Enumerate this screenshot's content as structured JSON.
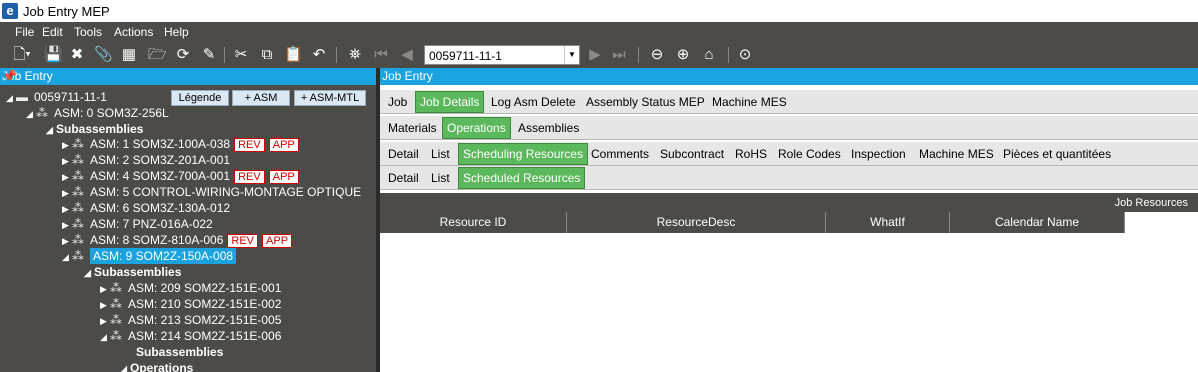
{
  "window": {
    "title": "Job Entry MEP",
    "logo": "e"
  },
  "menu": [
    "File",
    "Edit",
    "Tools",
    "Actions",
    "Help"
  ],
  "toolbar": {
    "job_number": "0059711-11-1"
  },
  "left_panel": {
    "title": "Job Entry",
    "buttons": {
      "legend": "Légende",
      "add_asm": "+ ASM",
      "add_asm_mtl": "+ ASM-MTL"
    },
    "tree": [
      {
        "label": "0059711-11-1"
      },
      {
        "label": "ASM: 0 SOM3Z-256L"
      },
      {
        "label": "Subassemblies"
      },
      {
        "label": "ASM: 1 SOM3Z-100A-038",
        "rev": "REV",
        "app": "APP"
      },
      {
        "label": "ASM: 2 SOM3Z-201A-001"
      },
      {
        "label": "ASM: 4 SOM3Z-700A-001",
        "rev": "REV",
        "app": "APP"
      },
      {
        "label": "ASM: 5 CONTROL-WIRING-MONTAGE OPTIQUE"
      },
      {
        "label": "ASM: 6 SOM3Z-130A-012"
      },
      {
        "label": "ASM: 7 PNZ-016A-022"
      },
      {
        "label": "ASM: 8 SOMZ-810A-006",
        "rev": "REV",
        "app": "APP"
      },
      {
        "label": "ASM: 9 SOM2Z-150A-008"
      },
      {
        "label": "Subassemblies"
      },
      {
        "label": "ASM: 209 SOM2Z-151E-001"
      },
      {
        "label": "ASM: 210 SOM2Z-151E-002"
      },
      {
        "label": "ASM: 213 SOM2Z-151E-005"
      },
      {
        "label": "ASM: 214 SOM2Z-151E-006"
      },
      {
        "label": "Subassemblies"
      },
      {
        "label": "Operations"
      }
    ]
  },
  "right_panel": {
    "title": "Job Entry",
    "tabs_l1": [
      "Job",
      "Job Details",
      "Log Asm Delete",
      "Assembly Status MEP",
      "Machine MES"
    ],
    "tabs_l2": [
      "Materials",
      "Operations",
      "Assemblies"
    ],
    "tabs_l3": [
      "Detail",
      "List",
      "Scheduling Resources",
      "Comments",
      "Subcontract",
      "RoHS",
      "Role Codes",
      "Inspection",
      "Machine MES",
      "Pièces et quantitées"
    ],
    "tabs_l4": [
      "Detail",
      "List",
      "Scheduled Resources"
    ],
    "grid_caption": "Job Resources",
    "columns": [
      "Resource ID",
      "ResourceDesc",
      "WhatIf",
      "Calendar Name"
    ]
  }
}
